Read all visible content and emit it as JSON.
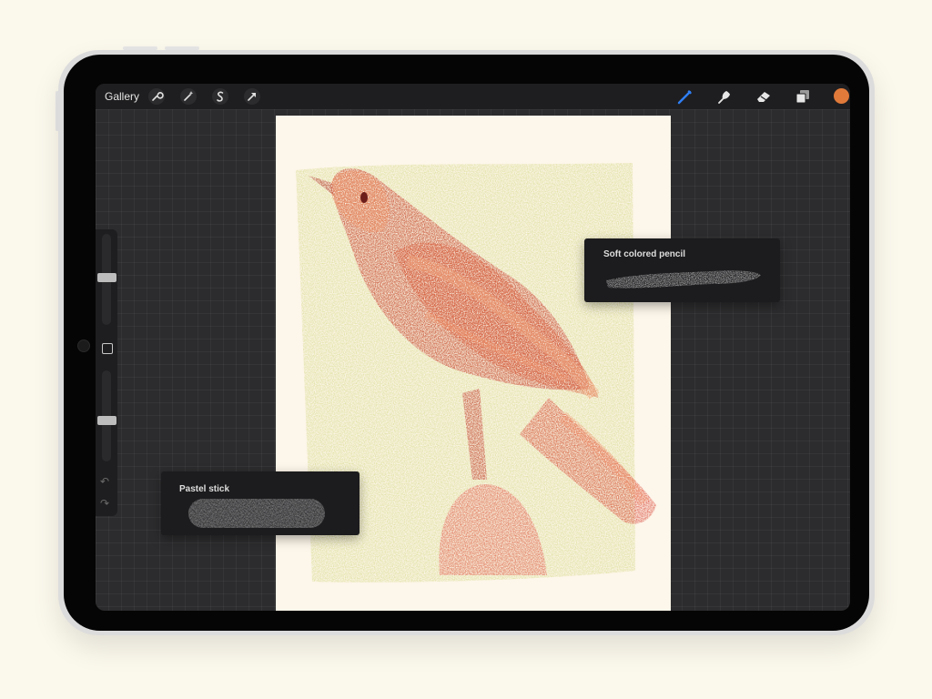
{
  "toolbar": {
    "gallery_label": "Gallery",
    "left_tools": [
      "wrench-icon",
      "magic-wand-icon",
      "selection-icon",
      "transform-arrow-icon"
    ],
    "right_tools": [
      "brush-icon",
      "smudge-icon",
      "eraser-icon",
      "layers-icon"
    ],
    "active_tool": "brush-icon",
    "active_color": "#e07a3a"
  },
  "sidebar": {
    "brush_size": 0.48,
    "brush_opacity": 0.55,
    "icons": [
      "modify-square-icon",
      "undo-icon",
      "redo-icon"
    ]
  },
  "brush_popups": {
    "soft_colored_pencil": {
      "label": "Soft colored pencil"
    },
    "pastel_stick": {
      "label": "Pastel stick"
    }
  },
  "colors": {
    "accent_blue": "#2f7ff5",
    "canvas_paper": "#fdf6ea",
    "background_green": "#d7db8f",
    "bird_red": "#c93a2e",
    "bird_orange": "#ee8a5c"
  }
}
